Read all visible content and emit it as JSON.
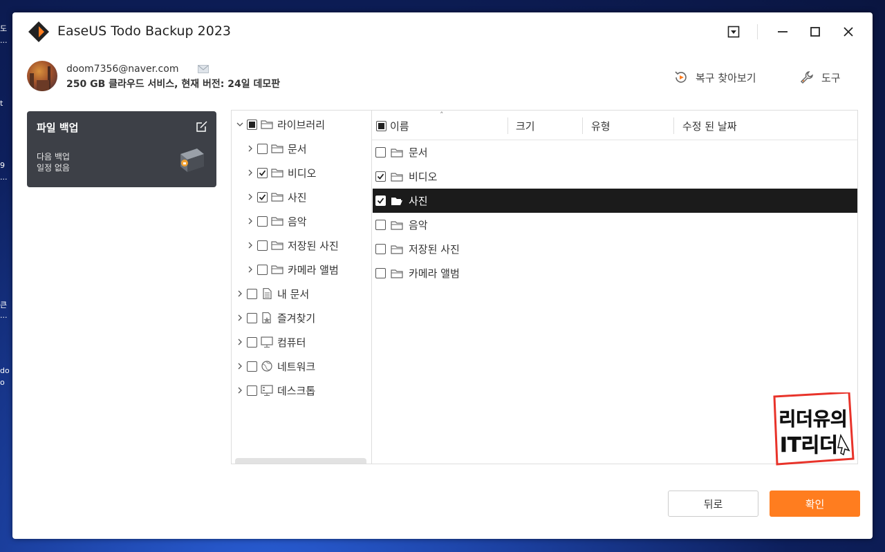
{
  "desktop_icons": [
    "도",
    "...",
    "t",
    "9",
    "...",
    "큰",
    "...",
    "do",
    "o"
  ],
  "window": {
    "title": "EaseUS Todo Backup 2023",
    "controls": [
      "dropdown-icon",
      "minimize-icon",
      "maximize-icon",
      "close-icon"
    ]
  },
  "account": {
    "email": "doom7356@naver.com",
    "plan": "250 GB 클라우드 서비스, 현재 버전: 24일 데모판"
  },
  "top_links": {
    "recovery": "복구 찾아보기",
    "tools": "도구"
  },
  "task": {
    "title": "파일 백업",
    "next_backup": "다음 백업",
    "schedule": "일정 없음"
  },
  "tree": [
    {
      "label": "라이브러리",
      "state": "partial",
      "expanded": true,
      "level": 0,
      "icon": "folder-icon"
    },
    {
      "label": "문서",
      "state": "unchecked",
      "level": 1,
      "icon": "folder-icon"
    },
    {
      "label": "비디오",
      "state": "checked",
      "level": 1,
      "icon": "folder-icon"
    },
    {
      "label": "사진",
      "state": "checked",
      "level": 1,
      "icon": "folder-icon"
    },
    {
      "label": "음악",
      "state": "unchecked",
      "level": 1,
      "icon": "folder-icon"
    },
    {
      "label": "저장된 사진",
      "state": "unchecked",
      "level": 1,
      "icon": "folder-icon"
    },
    {
      "label": "카메라 앨범",
      "state": "unchecked",
      "level": 1,
      "icon": "folder-icon"
    },
    {
      "label": "내 문서",
      "state": "unchecked",
      "level": 0,
      "icon": "document-icon"
    },
    {
      "label": "즐겨찾기",
      "state": "unchecked",
      "level": 0,
      "icon": "favorites-icon"
    },
    {
      "label": "컴퓨터",
      "state": "unchecked",
      "level": 0,
      "icon": "computer-icon"
    },
    {
      "label": "네트워크",
      "state": "unchecked",
      "level": 0,
      "icon": "network-icon"
    },
    {
      "label": "데스크톱",
      "state": "unchecked",
      "level": 0,
      "icon": "desktop-icon"
    }
  ],
  "list": {
    "columns": [
      "이름",
      "크기",
      "유형",
      "수정 된 날짜"
    ],
    "header_state": "partial",
    "rows": [
      {
        "name": "문서",
        "state": "unchecked",
        "selected": false
      },
      {
        "name": "비디오",
        "state": "checked",
        "selected": false
      },
      {
        "name": "사진",
        "state": "checked",
        "selected": true
      },
      {
        "name": "음악",
        "state": "unchecked",
        "selected": false
      },
      {
        "name": "저장된 사진",
        "state": "unchecked",
        "selected": false
      },
      {
        "name": "카메라 앨범",
        "state": "unchecked",
        "selected": false
      }
    ]
  },
  "watermark": {
    "line1": "리더유의",
    "line2": "IT리더"
  },
  "buttons": {
    "back": "뒤로",
    "ok": "확인"
  },
  "colors": {
    "accent": "#ff7d1f",
    "selected_row": "#1b1b1b",
    "task_card": "#3d4047"
  }
}
